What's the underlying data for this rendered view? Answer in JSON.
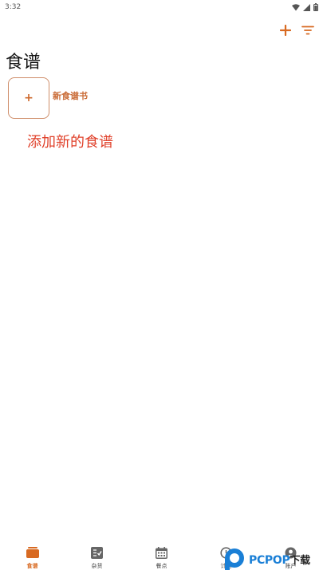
{
  "status_bar": {
    "time": "3:32"
  },
  "page": {
    "title": "食谱"
  },
  "new_cookbook": {
    "symbol": "+",
    "label": "新食谱书"
  },
  "hint": {
    "text": "添加新的食谱"
  },
  "bottom_nav": {
    "items": [
      {
        "label": "食谱",
        "icon": "cookbook-icon",
        "active": true
      },
      {
        "label": "杂货",
        "icon": "grocery-list-icon",
        "active": false
      },
      {
        "label": "餐点",
        "icon": "calendar-icon",
        "active": false
      },
      {
        "label": "计划",
        "icon": "planner-icon",
        "active": false
      },
      {
        "label": "账户",
        "icon": "account-icon",
        "active": false
      }
    ]
  },
  "watermark": {
    "text": "PCPOP",
    "suffix": "下载"
  },
  "colors": {
    "accent": "#d86a22",
    "hint_red": "#e0402a",
    "card_border": "#cf8e6a"
  }
}
